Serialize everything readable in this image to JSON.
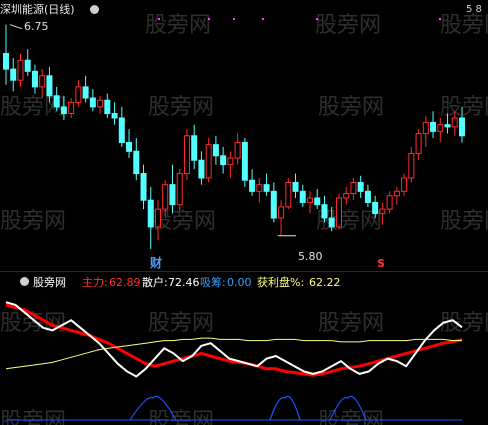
{
  "top_panel": {
    "title": "深圳能源(日线)",
    "high_label": "6.75",
    "low_label": "5.80",
    "marker_cai": "财",
    "marker_s": "S",
    "corner_label": "5 8"
  },
  "bottom_panel": {
    "indicator_name": "股旁网",
    "zhuli_label": "主力:",
    "zhuli_value": "62.89",
    "sanhu_label": "散户:",
    "sanhu_value": "72.46",
    "xichou_label": "吸筹:",
    "xichou_value": "0.00",
    "huolipan_label": "获利盘%:",
    "huolipan_value": "62.22"
  },
  "watermark_text": "股旁网",
  "colors": {
    "background": "#000000",
    "up_candle": "#ff2a2a",
    "down_candle": "#54ffff",
    "zhuli_line": "#ff0000",
    "sanhu_line": "#ffffff",
    "huolipan_line": "#ffff80",
    "xichou_area": "#1e50ff",
    "separator": "#8b0000"
  },
  "chart_data": [
    {
      "type": "candlestick",
      "title": "深圳能源(日线)",
      "annotations": [
        "6.75",
        "5.80",
        "财",
        "S"
      ],
      "candles": [
        {
          "o": 6.62,
          "h": 6.75,
          "l": 6.48,
          "c": 6.55
        },
        {
          "o": 6.55,
          "h": 6.6,
          "l": 6.45,
          "c": 6.5
        },
        {
          "o": 6.5,
          "h": 6.62,
          "l": 6.47,
          "c": 6.59
        },
        {
          "o": 6.59,
          "h": 6.64,
          "l": 6.52,
          "c": 6.54
        },
        {
          "o": 6.54,
          "h": 6.57,
          "l": 6.44,
          "c": 6.47
        },
        {
          "o": 6.47,
          "h": 6.55,
          "l": 6.42,
          "c": 6.52
        },
        {
          "o": 6.52,
          "h": 6.56,
          "l": 6.4,
          "c": 6.43
        },
        {
          "o": 6.43,
          "h": 6.47,
          "l": 6.36,
          "c": 6.38
        },
        {
          "o": 6.38,
          "h": 6.43,
          "l": 6.32,
          "c": 6.35
        },
        {
          "o": 6.35,
          "h": 6.42,
          "l": 6.33,
          "c": 6.4
        },
        {
          "o": 6.4,
          "h": 6.5,
          "l": 6.38,
          "c": 6.47
        },
        {
          "o": 6.47,
          "h": 6.52,
          "l": 6.4,
          "c": 6.42
        },
        {
          "o": 6.42,
          "h": 6.46,
          "l": 6.36,
          "c": 6.38
        },
        {
          "o": 6.38,
          "h": 6.43,
          "l": 6.35,
          "c": 6.41
        },
        {
          "o": 6.41,
          "h": 6.44,
          "l": 6.33,
          "c": 6.35
        },
        {
          "o": 6.35,
          "h": 6.4,
          "l": 6.3,
          "c": 6.33
        },
        {
          "o": 6.33,
          "h": 6.38,
          "l": 6.2,
          "c": 6.22
        },
        {
          "o": 6.22,
          "h": 6.28,
          "l": 6.15,
          "c": 6.18
        },
        {
          "o": 6.18,
          "h": 6.24,
          "l": 6.05,
          "c": 6.08
        },
        {
          "o": 6.08,
          "h": 6.12,
          "l": 5.92,
          "c": 5.96
        },
        {
          "o": 5.96,
          "h": 6.02,
          "l": 5.74,
          "c": 5.84
        },
        {
          "o": 5.84,
          "h": 5.96,
          "l": 5.78,
          "c": 5.92
        },
        {
          "o": 5.92,
          "h": 6.05,
          "l": 5.88,
          "c": 6.03
        },
        {
          "o": 6.03,
          "h": 6.12,
          "l": 5.9,
          "c": 5.94
        },
        {
          "o": 5.94,
          "h": 6.1,
          "l": 5.91,
          "c": 6.08
        },
        {
          "o": 6.08,
          "h": 6.28,
          "l": 6.05,
          "c": 6.25
        },
        {
          "o": 6.25,
          "h": 6.3,
          "l": 6.1,
          "c": 6.14
        },
        {
          "o": 6.14,
          "h": 6.18,
          "l": 6.03,
          "c": 6.06
        },
        {
          "o": 6.06,
          "h": 6.24,
          "l": 6.04,
          "c": 6.21
        },
        {
          "o": 6.21,
          "h": 6.25,
          "l": 6.12,
          "c": 6.16
        },
        {
          "o": 6.16,
          "h": 6.2,
          "l": 6.08,
          "c": 6.12
        },
        {
          "o": 6.12,
          "h": 6.18,
          "l": 6.06,
          "c": 6.15
        },
        {
          "o": 6.15,
          "h": 6.26,
          "l": 6.12,
          "c": 6.22
        },
        {
          "o": 6.22,
          "h": 6.24,
          "l": 6.02,
          "c": 6.05
        },
        {
          "o": 6.05,
          "h": 6.1,
          "l": 5.98,
          "c": 6.0
        },
        {
          "o": 6.0,
          "h": 6.06,
          "l": 5.95,
          "c": 6.03
        },
        {
          "o": 6.03,
          "h": 6.08,
          "l": 5.98,
          "c": 6.0
        },
        {
          "o": 6.0,
          "h": 6.04,
          "l": 5.86,
          "c": 5.88
        },
        {
          "o": 5.88,
          "h": 5.96,
          "l": 5.8,
          "c": 5.93
        },
        {
          "o": 5.93,
          "h": 6.06,
          "l": 5.92,
          "c": 6.04
        },
        {
          "o": 6.04,
          "h": 6.08,
          "l": 5.97,
          "c": 6.0
        },
        {
          "o": 6.0,
          "h": 6.03,
          "l": 5.93,
          "c": 5.95
        },
        {
          "o": 5.95,
          "h": 6.0,
          "l": 5.9,
          "c": 5.97
        },
        {
          "o": 5.97,
          "h": 6.01,
          "l": 5.92,
          "c": 5.94
        },
        {
          "o": 5.94,
          "h": 5.98,
          "l": 5.86,
          "c": 5.88
        },
        {
          "o": 5.88,
          "h": 5.93,
          "l": 5.82,
          "c": 5.84
        },
        {
          "o": 5.84,
          "h": 5.99,
          "l": 5.83,
          "c": 5.97
        },
        {
          "o": 5.97,
          "h": 6.02,
          "l": 5.94,
          "c": 5.99
        },
        {
          "o": 5.99,
          "h": 6.06,
          "l": 5.96,
          "c": 6.04
        },
        {
          "o": 6.04,
          "h": 6.07,
          "l": 5.97,
          "c": 6.0
        },
        {
          "o": 6.0,
          "h": 6.03,
          "l": 5.93,
          "c": 5.95
        },
        {
          "o": 5.95,
          "h": 5.98,
          "l": 5.88,
          "c": 5.9
        },
        {
          "o": 5.9,
          "h": 5.95,
          "l": 5.85,
          "c": 5.92
        },
        {
          "o": 5.92,
          "h": 6.0,
          "l": 5.9,
          "c": 5.98
        },
        {
          "o": 5.98,
          "h": 6.02,
          "l": 5.94,
          "c": 6.0
        },
        {
          "o": 6.0,
          "h": 6.08,
          "l": 5.98,
          "c": 6.06
        },
        {
          "o": 6.06,
          "h": 6.2,
          "l": 6.04,
          "c": 6.17
        },
        {
          "o": 6.17,
          "h": 6.28,
          "l": 6.14,
          "c": 6.26
        },
        {
          "o": 6.26,
          "h": 6.34,
          "l": 6.2,
          "c": 6.31
        },
        {
          "o": 6.31,
          "h": 6.36,
          "l": 6.24,
          "c": 6.27
        },
        {
          "o": 6.27,
          "h": 6.33,
          "l": 6.22,
          "c": 6.3
        },
        {
          "o": 6.3,
          "h": 6.35,
          "l": 6.26,
          "c": 6.29
        },
        {
          "o": 6.29,
          "h": 6.36,
          "l": 6.25,
          "c": 6.33
        },
        {
          "o": 6.33,
          "h": 6.38,
          "l": 6.22,
          "c": 6.25
        }
      ]
    },
    {
      "type": "line",
      "series": [
        {
          "name": "主力",
          "values": [
            90,
            88,
            86,
            82,
            78,
            74,
            72,
            70,
            68,
            66,
            63,
            60,
            56,
            52,
            48,
            44,
            42,
            44,
            46,
            48,
            50,
            52,
            50,
            48,
            46,
            45,
            44,
            42,
            40,
            40,
            38,
            37,
            36,
            35,
            36,
            38,
            40,
            41,
            42,
            44,
            46,
            48,
            50,
            52,
            54,
            56,
            58,
            60,
            61,
            62.89
          ]
        },
        {
          "name": "散户",
          "values": [
            92,
            90,
            84,
            78,
            72,
            70,
            74,
            78,
            72,
            66,
            60,
            52,
            44,
            38,
            34,
            40,
            48,
            56,
            52,
            46,
            50,
            58,
            60,
            54,
            48,
            46,
            44,
            42,
            48,
            50,
            46,
            42,
            38,
            36,
            38,
            42,
            46,
            40,
            36,
            38,
            44,
            48,
            46,
            42,
            52,
            62,
            70,
            76,
            78,
            72.46
          ]
        },
        {
          "name": "获利盘%",
          "values": [
            40,
            41,
            42,
            43,
            44,
            45,
            47,
            49,
            51,
            53,
            55,
            56,
            57,
            58,
            59,
            60,
            61,
            62,
            62,
            63,
            63,
            64,
            64,
            63,
            63,
            63,
            62,
            62,
            62,
            63,
            63,
            63,
            62,
            62,
            62,
            62,
            61,
            61,
            61,
            62,
            62,
            62,
            62,
            62,
            63,
            63,
            63,
            63,
            62,
            62.22
          ]
        },
        {
          "name": "吸筹",
          "values": [
            0,
            0,
            0,
            0,
            0,
            0,
            0,
            0,
            0,
            0,
            0,
            0,
            0,
            0,
            0,
            0,
            0,
            0,
            0,
            0,
            0,
            0,
            0,
            0,
            0,
            0,
            0,
            0,
            0,
            0,
            0,
            0,
            0,
            0,
            0,
            0,
            0,
            0,
            0,
            0,
            0,
            0,
            0,
            0,
            0,
            0,
            0,
            0,
            0,
            0
          ]
        }
      ]
    }
  ]
}
